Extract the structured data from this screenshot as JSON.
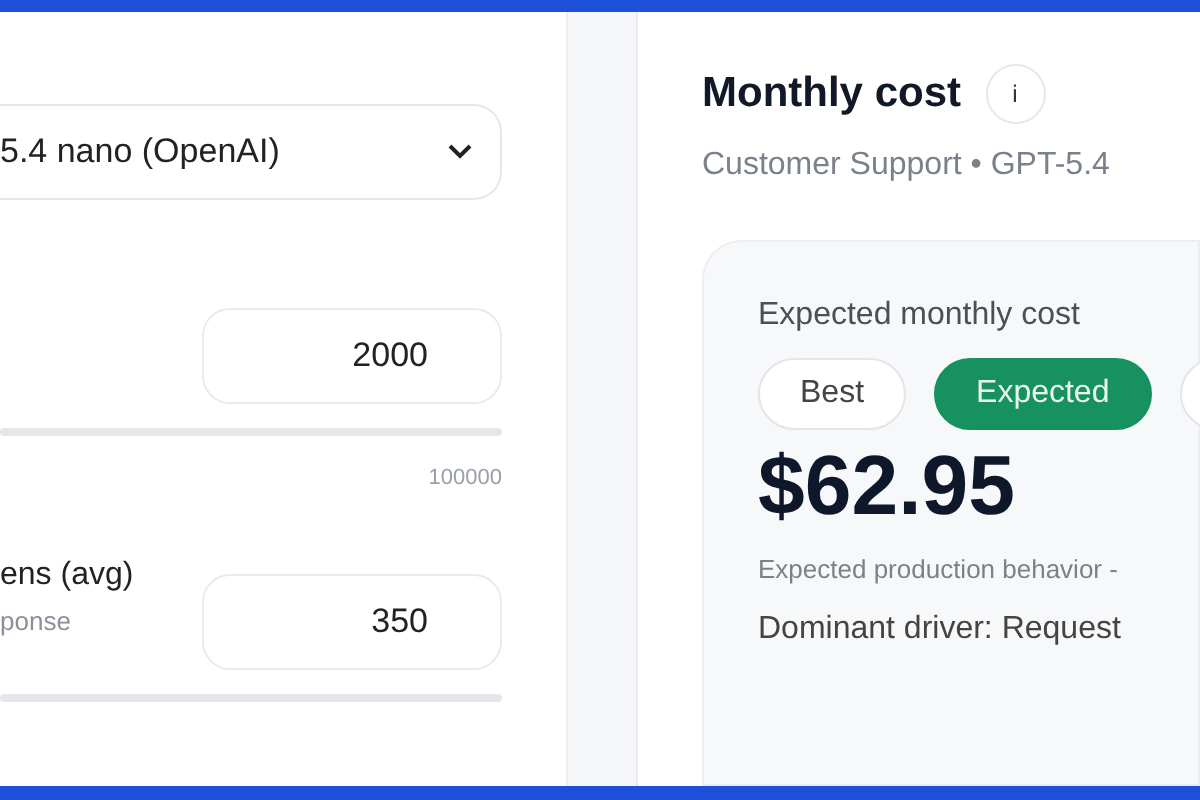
{
  "left_panel": {
    "model_select": {
      "value": "5.4 nano (OpenAI)"
    },
    "requests": {
      "value": "2000",
      "slider_max": "100000"
    },
    "output_tokens": {
      "label": "ens (avg)",
      "hint": "ponse",
      "value": "350"
    }
  },
  "right_panel": {
    "title": "Monthly cost",
    "info_icon": "i",
    "subtitle": "Customer Support • GPT-5.4",
    "card": {
      "label": "Expected monthly cost",
      "scenarios": [
        {
          "label": "Best",
          "selected": false
        },
        {
          "label": "Expected",
          "selected": true
        },
        {
          "selected": false
        }
      ],
      "amount": "$62.95",
      "note": "Expected production behavior -",
      "driver": "Dominant driver: Request"
    }
  }
}
